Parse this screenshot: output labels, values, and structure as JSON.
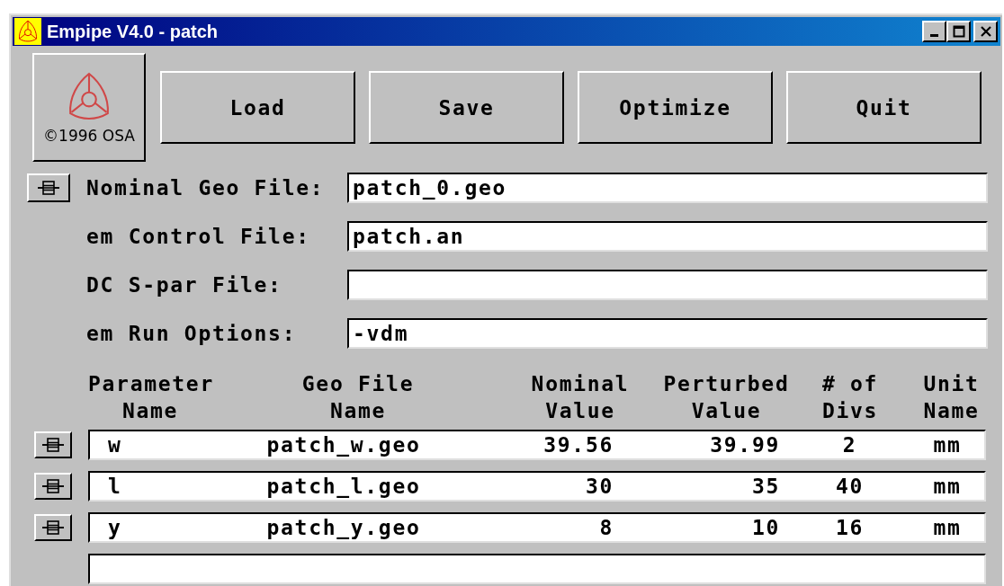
{
  "window": {
    "title": "Empipe V4.0 - patch"
  },
  "logo": {
    "caption": "©1996 OSA"
  },
  "buttons": [
    {
      "label": "Load"
    },
    {
      "label": "Save"
    },
    {
      "label": "Optimize"
    },
    {
      "label": "Quit"
    }
  ],
  "files": [
    {
      "label": "Nominal Geo File:",
      "value": "patch_0.geo",
      "has_button": true
    },
    {
      "label": "em Control File:",
      "value": "patch.an",
      "has_button": false
    },
    {
      "label": "DC S-par File:",
      "has_button": false
    },
    {
      "label": "em Run Options:",
      "value": "-vdm",
      "has_button": false
    }
  ],
  "table": {
    "columns": [
      "Parameter\nName",
      "Geo File\nName",
      "Nominal\nValue",
      "Perturbed\nValue",
      "# of\nDivs",
      "Unit\nName"
    ],
    "rows": [
      {
        "cells": [
          "w",
          "patch_w.geo",
          "39.56",
          "39.99",
          "2",
          "mm"
        ]
      },
      {
        "cells": [
          "l",
          "patch_l.geo",
          "30",
          "35",
          "40",
          "mm"
        ]
      },
      {
        "cells": [
          "y",
          "patch_y.geo",
          "8",
          "10",
          "16",
          "mm"
        ]
      }
    ]
  }
}
